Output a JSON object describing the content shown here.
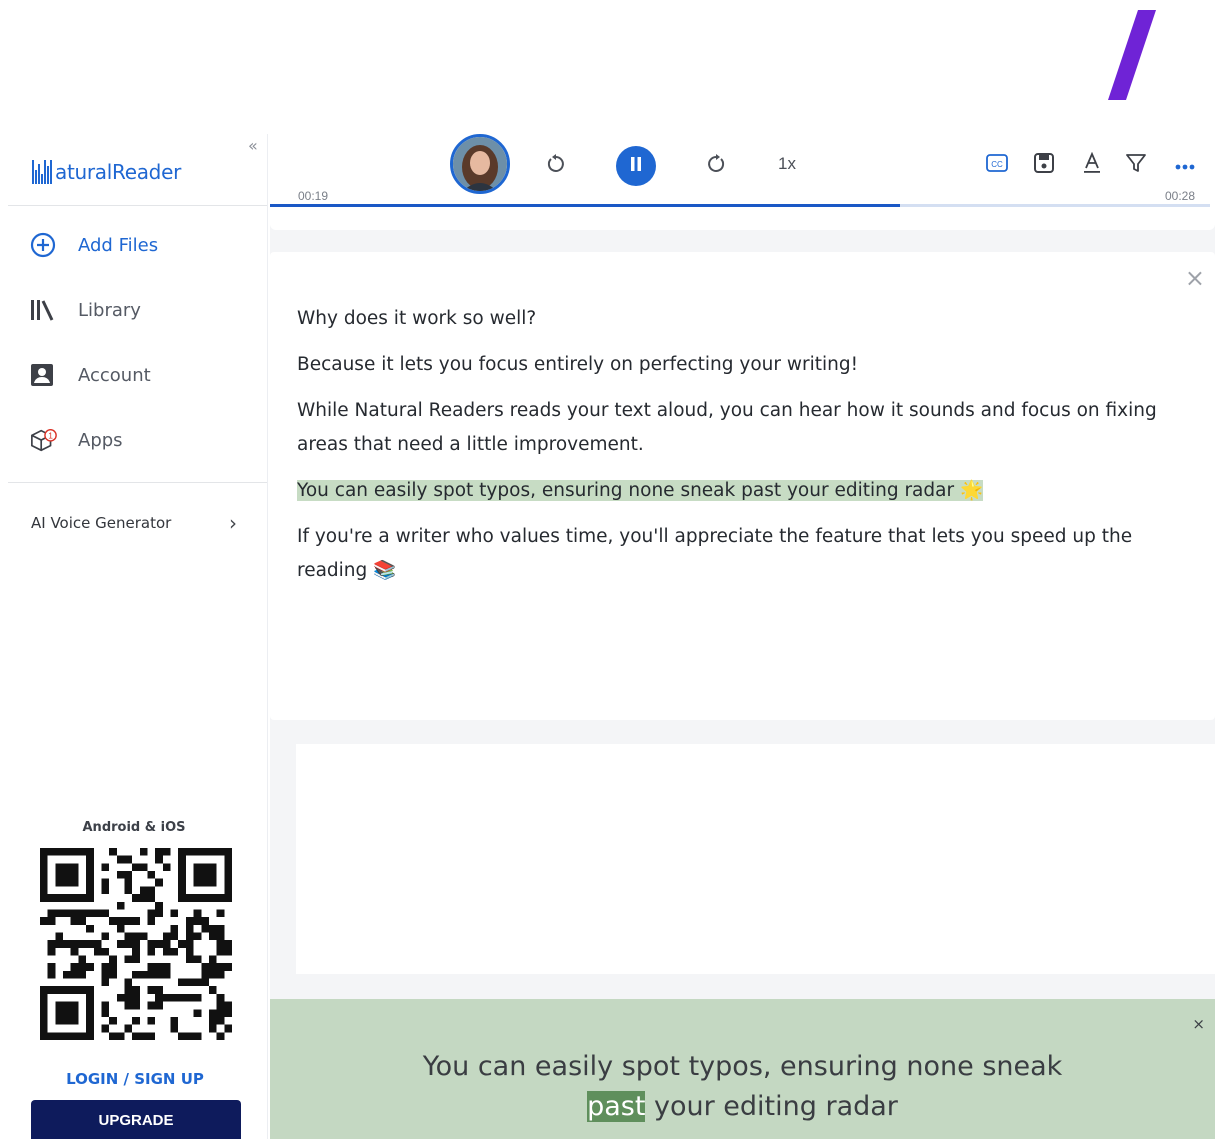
{
  "sidebar": {
    "logo_text": "aturalReader",
    "collapse_glyph": "«",
    "nav": [
      {
        "label": "Add Files",
        "icon": "add-circle-icon"
      },
      {
        "label": "Library",
        "icon": "library-icon"
      },
      {
        "label": "Account",
        "icon": "account-icon"
      },
      {
        "label": "Apps",
        "icon": "apps-icon",
        "badge": "1"
      }
    ],
    "ai_voice": "AI Voice Generator",
    "store_label": "Android & iOS",
    "login": "LOGIN / SIGN UP",
    "upgrade": "UPGRADE"
  },
  "player": {
    "speed": "1x",
    "elapsed": "00:19",
    "total": "00:28",
    "progress": 0.67,
    "cc_label": "CC",
    "accent": "#1f67d2"
  },
  "document": {
    "paragraphs": [
      "Why does it work so well?",
      "Because it lets you focus entirely on perfecting your writing!",
      "While Natural Readers reads your text aloud, you can hear how it sounds and focus on fixing areas that need a little improvement.",
      "You can easily spot typos, ensuring none sneak past your editing radar 🌟",
      "If you're a writer who values time, you'll appreciate the feature that lets you speed up the reading 📚"
    ]
  },
  "caption": {
    "before": "You can easily spot typos, ensuring none sneak",
    "current_word": "past",
    "after": " your editing radar",
    "close": "×"
  }
}
